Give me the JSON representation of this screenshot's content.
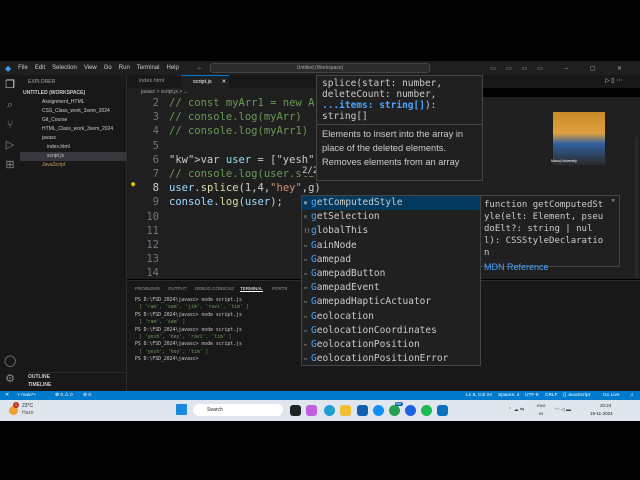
{
  "titlebar": {
    "menu": [
      "File",
      "Edit",
      "Selection",
      "View",
      "Go",
      "Run",
      "Terminal",
      "Help"
    ],
    "search": "Untitled (Workspace)"
  },
  "explorer": {
    "header": "EXPLORER",
    "workspace": "UNTITLED (WORKSPACE)",
    "items": [
      "Assignment_HTML",
      "CSS_Class_work_3sem_2024",
      "Git_Course",
      "HTML_Class_work_3sem_2024",
      "javasc",
      "index.html",
      "script.js",
      "JavaScript"
    ],
    "outline": "OUTLINE",
    "timeline": "TIMELINE"
  },
  "tabs": [
    "index.html",
    "script.js"
  ],
  "breadcrumb": "javasc > script.js > ...",
  "editor": {
    "lines": [
      {
        "n": "2",
        "t": "// const myArr1 = new A",
        "c": "cm"
      },
      {
        "n": "3",
        "t": "// console.log(myArr)",
        "c": "cm"
      },
      {
        "n": "4",
        "t": "// console.log(myArr1)",
        "c": "cm"
      },
      {
        "n": "5",
        "t": "",
        "c": ""
      },
      {
        "n": "6",
        "t": "var user = [\"yesh\",\"ram",
        "c": "mix6"
      },
      {
        "n": "7",
        "t": "// console.log(user.sli",
        "c": "cm"
      },
      {
        "n": "8",
        "t": "user.splice(1,4,\"hey\",g)",
        "c": "mix8"
      },
      {
        "n": "9",
        "t": "console.log(user);",
        "c": "mix9"
      },
      {
        "n": "10",
        "t": "",
        "c": ""
      },
      {
        "n": "11",
        "t": "",
        "c": ""
      },
      {
        "n": "12",
        "t": "",
        "c": ""
      },
      {
        "n": "13",
        "t": "",
        "c": ""
      },
      {
        "n": "14",
        "t": "",
        "c": ""
      }
    ],
    "overload": "2/2"
  },
  "param_hint": {
    "sig1": "splice(start: number,",
    "sig2": "deleteCount: number,",
    "sig3": "...items: string[]",
    "sig3b": "):",
    "sig4": "string[]",
    "doc1": "Elements to insert into the array in",
    "doc2": "place of the deleted elements.",
    "doc3": "Removes elements from an array"
  },
  "suggestions": [
    "getComputedStyle",
    "getSelection",
    "globalThis",
    "GainNode",
    "Gamepad",
    "GamepadButton",
    "GamepadEvent",
    "GamepadHapticActuator",
    "Geolocation",
    "GeolocationCoordinates",
    "GeolocationPosition",
    "GeolocationPositionError"
  ],
  "details": {
    "text": "function getComputedStyle(elt: Element, pseudoElt?: string | null): CSSStyleDeclaration",
    "link": "MDN Reference"
  },
  "panel": {
    "tabs": [
      "PROBLEMS",
      "OUTPUT",
      "DEBUG CONSOLE",
      "TERMINAL",
      "PORTS"
    ],
    "terminal": [
      "PS D:\\FSD_2024\\javasc> node script.js",
      "[ 'ram', 'sam', 'jim', 'ravi', 'tim' ]",
      "PS D:\\FSD_2024\\javasc> node script.js",
      "[ 'ram', 'sam' ]",
      "PS D:\\FSD_2024\\javasc> node script.js",
      "[ 'yesh', 'hey', 'ravi', 'tim' ]",
      "PS D:\\FSD_2024\\javasc> node script.js",
      "[ 'yesh', 'hey', 'tim' ]",
      "PS D:\\FSD_2024\\javasc> "
    ]
  },
  "webcam": {
    "label": "Manoj University"
  },
  "status": {
    "branch": "main*+",
    "problems": "⊗ 0 ⚠ 0",
    "ports": "0",
    "right": [
      "Ln 8, Col 24",
      "Spaces: 4",
      "UTF-8",
      "CRLF",
      "{} JavaScript",
      "Go Live"
    ]
  },
  "taskbar": {
    "temp": "23°C",
    "weather": "Haze",
    "search": "Search",
    "lang": "ENG",
    "region": "IN",
    "time": "20:24",
    "date": "19-11-2024",
    "badge": "99+",
    "notif": "1"
  }
}
